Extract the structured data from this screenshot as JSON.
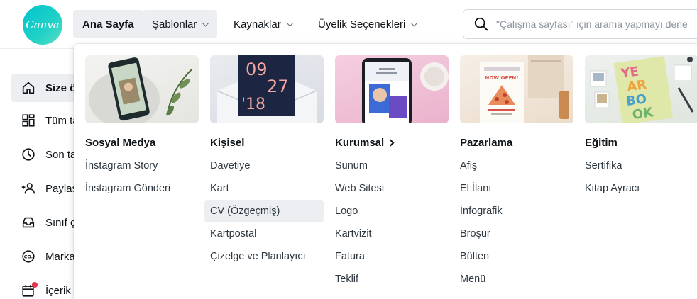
{
  "brand": {
    "logo_text": "Canva",
    "accent": "#00c4cc"
  },
  "nav": {
    "home": "Ana Sayfa",
    "templates": "Şablonlar",
    "resources": "Kaynaklar",
    "plans": "Üyelik Seçenekleri"
  },
  "search": {
    "placeholder": "\"Çalışma sayfası\" için arama yapmayı dene"
  },
  "sidebar": {
    "items": [
      {
        "label": "Size özel",
        "icon": "home-icon"
      },
      {
        "label": "Tüm tasarımlar",
        "icon": "grid-icon"
      },
      {
        "label": "Son tasarımlar",
        "icon": "clock-icon"
      },
      {
        "label": "Paylaşılanlar",
        "icon": "people-icon"
      },
      {
        "label": "Sınıf çalışmaları",
        "icon": "inbox-icon"
      },
      {
        "label": "Marka Kiti",
        "icon": "brand-kit-icon"
      },
      {
        "label": "İçerik Planlayıcı",
        "icon": "calendar-icon"
      }
    ]
  },
  "menu": {
    "columns": [
      {
        "title": "Sosyal Medya",
        "links": [
          "İnstagram Story",
          "İnstagram Gönderi"
        ]
      },
      {
        "title": "Kişisel",
        "links": [
          "Davetiye",
          "Kart",
          "CV (Özgeçmiş)",
          "Kartpostal",
          "Çizelge ve Planlayıcı"
        ]
      },
      {
        "title": "Kurumsal",
        "links": [
          "Sunum",
          "Web Sitesi",
          "Logo",
          "Kartvizit",
          "Fatura",
          "Teklif"
        ]
      },
      {
        "title": "Pazarlama",
        "links": [
          "Afiş",
          "El İlanı",
          "İnfografik",
          "Broşür",
          "Bülten",
          "Menü"
        ]
      },
      {
        "title": "Eğitim",
        "links": [
          "Sertifika",
          "Kitap Ayracı"
        ]
      }
    ],
    "thumbnails": {
      "personal_date_top": "09",
      "personal_date_mid": "27",
      "personal_date_bottom": "'18",
      "marketing_poster": "NOW OPEN!",
      "edu_letters": [
        "YE",
        "AR",
        "BO",
        "OK"
      ]
    }
  }
}
